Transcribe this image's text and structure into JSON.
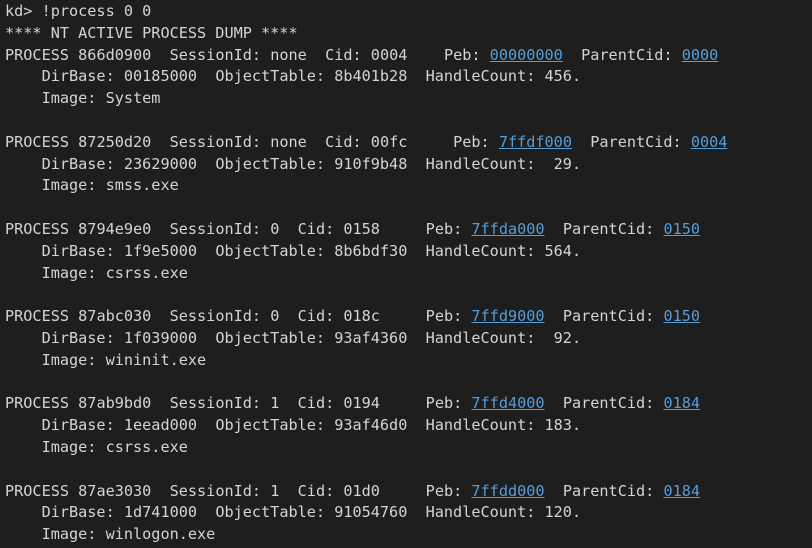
{
  "console": {
    "command_line": "kd> !process 0 0",
    "banner": "**** NT ACTIVE PROCESS DUMP ****",
    "processes": [
      {
        "address": "866d0900",
        "session_id": "none",
        "cid": "0004",
        "peb": "00000000",
        "parent_cid": "0000",
        "dir_base": "00185000",
        "object_table": "8b401b28",
        "handle_count": "456.",
        "image": "System",
        "gap_sess": "  ",
        "gap_cid": "    ",
        "gap_peb": "  ",
        "gap_hc": " "
      },
      {
        "address": "87250d20",
        "session_id": "none",
        "cid": "00fc",
        "peb": "7ffdf000",
        "parent_cid": "0004",
        "dir_base": "23629000",
        "object_table": "910f9b48",
        "handle_count": "29.",
        "image": "smss.exe",
        "gap_sess": "  ",
        "gap_cid": "     ",
        "gap_peb": "  ",
        "gap_hc": "  "
      },
      {
        "address": "8794e9e0",
        "session_id": "0",
        "cid": "0158",
        "peb": "7ffda000",
        "parent_cid": "0150",
        "dir_base": "1f9e5000",
        "object_table": "8b6bdf30",
        "handle_count": "564.",
        "image": "csrss.exe",
        "gap_sess": "  ",
        "gap_cid": "     ",
        "gap_peb": "  ",
        "gap_hc": " "
      },
      {
        "address": "87abc030",
        "session_id": "0",
        "cid": "018c",
        "peb": "7ffd9000",
        "parent_cid": "0150",
        "dir_base": "1f039000",
        "object_table": "93af4360",
        "handle_count": "92.",
        "image": "wininit.exe",
        "gap_sess": "  ",
        "gap_cid": "     ",
        "gap_peb": "  ",
        "gap_hc": "  "
      },
      {
        "address": "87ab9bd0",
        "session_id": "1",
        "cid": "0194",
        "peb": "7ffd4000",
        "parent_cid": "0184",
        "dir_base": "1eead000",
        "object_table": "93af46d0",
        "handle_count": "183.",
        "image": "csrss.exe",
        "gap_sess": "  ",
        "gap_cid": "     ",
        "gap_peb": "  ",
        "gap_hc": " "
      },
      {
        "address": "87ae3030",
        "session_id": "1",
        "cid": "01d0",
        "peb": "7ffdd000",
        "parent_cid": "0184",
        "dir_base": "1d741000",
        "object_table": "91054760",
        "handle_count": "120.",
        "image": "winlogon.exe",
        "gap_sess": "  ",
        "gap_cid": "     ",
        "gap_peb": "  ",
        "gap_hc": " "
      }
    ]
  },
  "colors": {
    "background": "#1e1e1e",
    "text": "#d4d4d4",
    "link": "#569cd6"
  }
}
